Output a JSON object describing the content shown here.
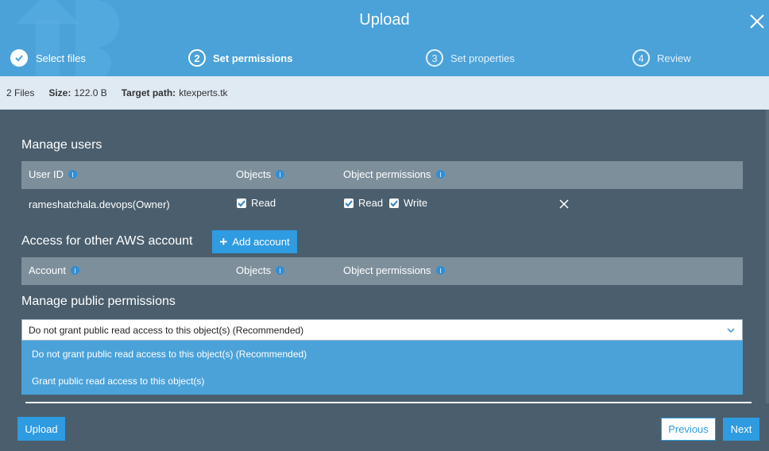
{
  "header": {
    "title": "Upload",
    "steps": [
      {
        "num": "",
        "label": "Select files",
        "state": "done"
      },
      {
        "num": "2",
        "label": "Set permissions",
        "state": "active"
      },
      {
        "num": "3",
        "label": "Set properties",
        "state": "pending"
      },
      {
        "num": "4",
        "label": "Review",
        "state": "pending"
      }
    ]
  },
  "info": {
    "files": "2 Files",
    "size_key": "Size:",
    "size_val": "122.0 B",
    "path_key": "Target path:",
    "path_val": "ktexperts.tk"
  },
  "manage_users": {
    "title": "Manage users",
    "columns": [
      "User ID",
      "Objects",
      "Object permissions"
    ],
    "rows": [
      {
        "user": "rameshatchala.devops(Owner)",
        "objects_read": "Read",
        "perm_read": "Read",
        "perm_write": "Write"
      }
    ]
  },
  "other_accounts": {
    "title": "Access for other AWS account",
    "add_button": "Add account",
    "columns": [
      "Account",
      "Objects",
      "Object permissions"
    ]
  },
  "public": {
    "title": "Manage public permissions",
    "selected": "Do not grant public read access to this object(s) (Recommended)",
    "options": [
      "Do not grant public read access to this object(s) (Recommended)",
      "Grant public read access to this object(s)"
    ]
  },
  "footer": {
    "upload": "Upload",
    "previous": "Previous",
    "next": "Next"
  },
  "colors": {
    "header": "#4aa2d9",
    "body": "#4a5e6d",
    "accent": "#2f9be0"
  }
}
